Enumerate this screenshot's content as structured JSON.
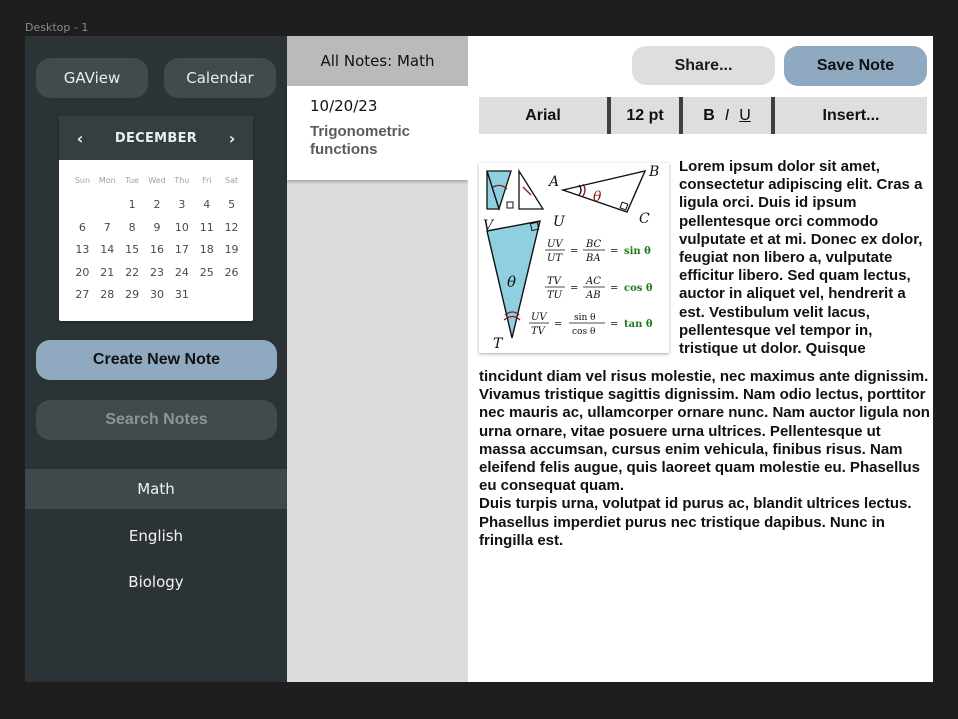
{
  "frame_label": "Desktop - 1",
  "sidebar": {
    "gaview_label": "GAView",
    "calendar_label": "Calendar",
    "calendar": {
      "month": "DECEMBER",
      "prev": "‹",
      "next": "›",
      "weekdays": [
        "Sun",
        "Mon",
        "Tue",
        "Wed",
        "Thu",
        "Fri",
        "Sat"
      ],
      "days": [
        "",
        "",
        "1",
        "2",
        "3",
        "4",
        "5",
        "6",
        "7",
        "8",
        "9",
        "10",
        "11",
        "12",
        "13",
        "14",
        "15",
        "16",
        "17",
        "18",
        "19",
        "20",
        "21",
        "22",
        "23",
        "24",
        "25",
        "26",
        "27",
        "28",
        "29",
        "30",
        "31"
      ]
    },
    "create_label": "Create New Note",
    "search_placeholder": "Search Notes",
    "subjects": [
      {
        "label": "Math",
        "active": true
      },
      {
        "label": "English",
        "active": false
      },
      {
        "label": "Biology",
        "active": false
      }
    ]
  },
  "notes": {
    "header": "All Notes: Math",
    "items": [
      {
        "date": "10/20/23",
        "title": "Trigonometric functions"
      }
    ]
  },
  "editor": {
    "share_label": "Share...",
    "save_label": "Save Note",
    "toolbar": {
      "font": "Arial",
      "size": "12 pt",
      "bold": "B",
      "italic": "I",
      "underline": "U",
      "insert": "Insert..."
    },
    "figure": {
      "labels": {
        "A": "A",
        "B": "B",
        "C": "C",
        "T": "T",
        "U": "U",
        "V": "V",
        "theta": "θ"
      },
      "eq1": {
        "lhs_num": "UV",
        "lhs_den": "UT",
        "mid_num": "BC",
        "mid_den": "BA",
        "rhs": "sin θ"
      },
      "eq2": {
        "lhs_num": "TV",
        "lhs_den": "TU",
        "mid_num": "AC",
        "mid_den": "AB",
        "rhs": "cos θ"
      },
      "eq3": {
        "lhs_num": "UV",
        "lhs_den": "TV",
        "mid_num": "sin θ",
        "mid_den": "cos θ",
        "rhs": "tan θ"
      }
    },
    "text_right": "Lorem ipsum dolor sit amet, consectetur adipiscing elit. Cras a ligula orci. Duis id ipsum pellentesque orci commodo vulputate et at mi. Donec ex dolor, feugiat non libero a, vulputate efficitur libero. Sed quam lectus, auctor in aliquet vel, hendrerit a est. Vestibulum velit lacus, pellentesque vel tempor in, tristique ut dolor. Quisque",
    "text_bottom_1": "tincidunt diam vel risus molestie, nec maximus ante dignissim. Vivamus tristique sagittis dignissim. Nam odio lectus, porttitor nec mauris ac, ullamcorper ornare nunc. Nam auctor ligula non urna ornare, vitae posuere urna ultrices. Pellentesque ut massa accumsan, cursus enim vehicula, finibus risus. Nam eleifend felis augue, quis laoreet quam molestie eu. Phasellus eu consequat quam.",
    "text_bottom_2": "Duis turpis urna, volutpat id purus ac, blandit ultrices lectus. Phasellus imperdiet purus nec tristique dapibus. Nunc in fringilla est."
  },
  "colors": {
    "sidebar_bg": "#2b3336",
    "accent_blue": "#8fa9c0",
    "triangle_fill": "#8ecfe0",
    "trig_green": "#1f7a1f"
  }
}
